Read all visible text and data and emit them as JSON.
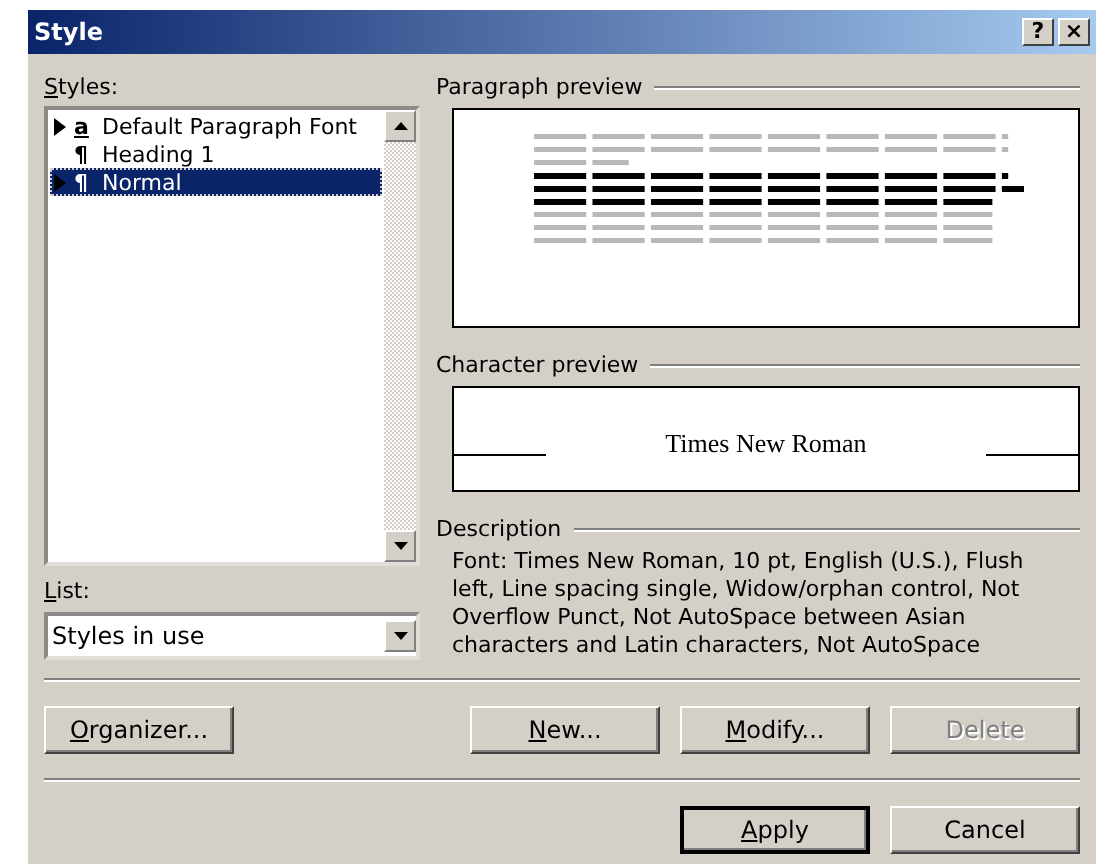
{
  "window": {
    "title": "Style",
    "help": "?",
    "close": "×"
  },
  "styles_label": {
    "key": "S",
    "after": "tyles:"
  },
  "styles": [
    {
      "glyph": "a",
      "kind": "character",
      "marker": true,
      "name": "Default Paragraph Font",
      "selected": false
    },
    {
      "glyph": "¶",
      "kind": "paragraph",
      "marker": false,
      "name": "Heading 1",
      "selected": false
    },
    {
      "glyph": "¶",
      "kind": "paragraph",
      "marker": true,
      "name": "Normal",
      "selected": true
    }
  ],
  "list_label": {
    "key": "L",
    "after": "ist:"
  },
  "list_value": "Styles in use",
  "paragraph_preview": {
    "title": "Paragraph preview"
  },
  "character_preview": {
    "title": "Character preview",
    "sample": "Times New Roman"
  },
  "description": {
    "title": "Description",
    "text": "Font: Times New Roman, 10 pt, English (U.S.), Flush left, Line spacing single, Widow/orphan control, Not Overflow Punct, Not AutoSpace between Asian characters and Latin characters, Not AutoSpace"
  },
  "action_buttons": [
    {
      "key": "O",
      "after": "rganizer...",
      "disabled": false
    },
    {
      "key": "N",
      "after": "ew...",
      "disabled": false
    },
    {
      "key": "M",
      "after": "odify...",
      "disabled": false
    },
    {
      "before": "Delete",
      "disabled": true
    }
  ],
  "dialog_buttons": [
    {
      "key": "A",
      "after": "pply",
      "default": true
    },
    {
      "before": "Cancel",
      "default": false
    }
  ]
}
